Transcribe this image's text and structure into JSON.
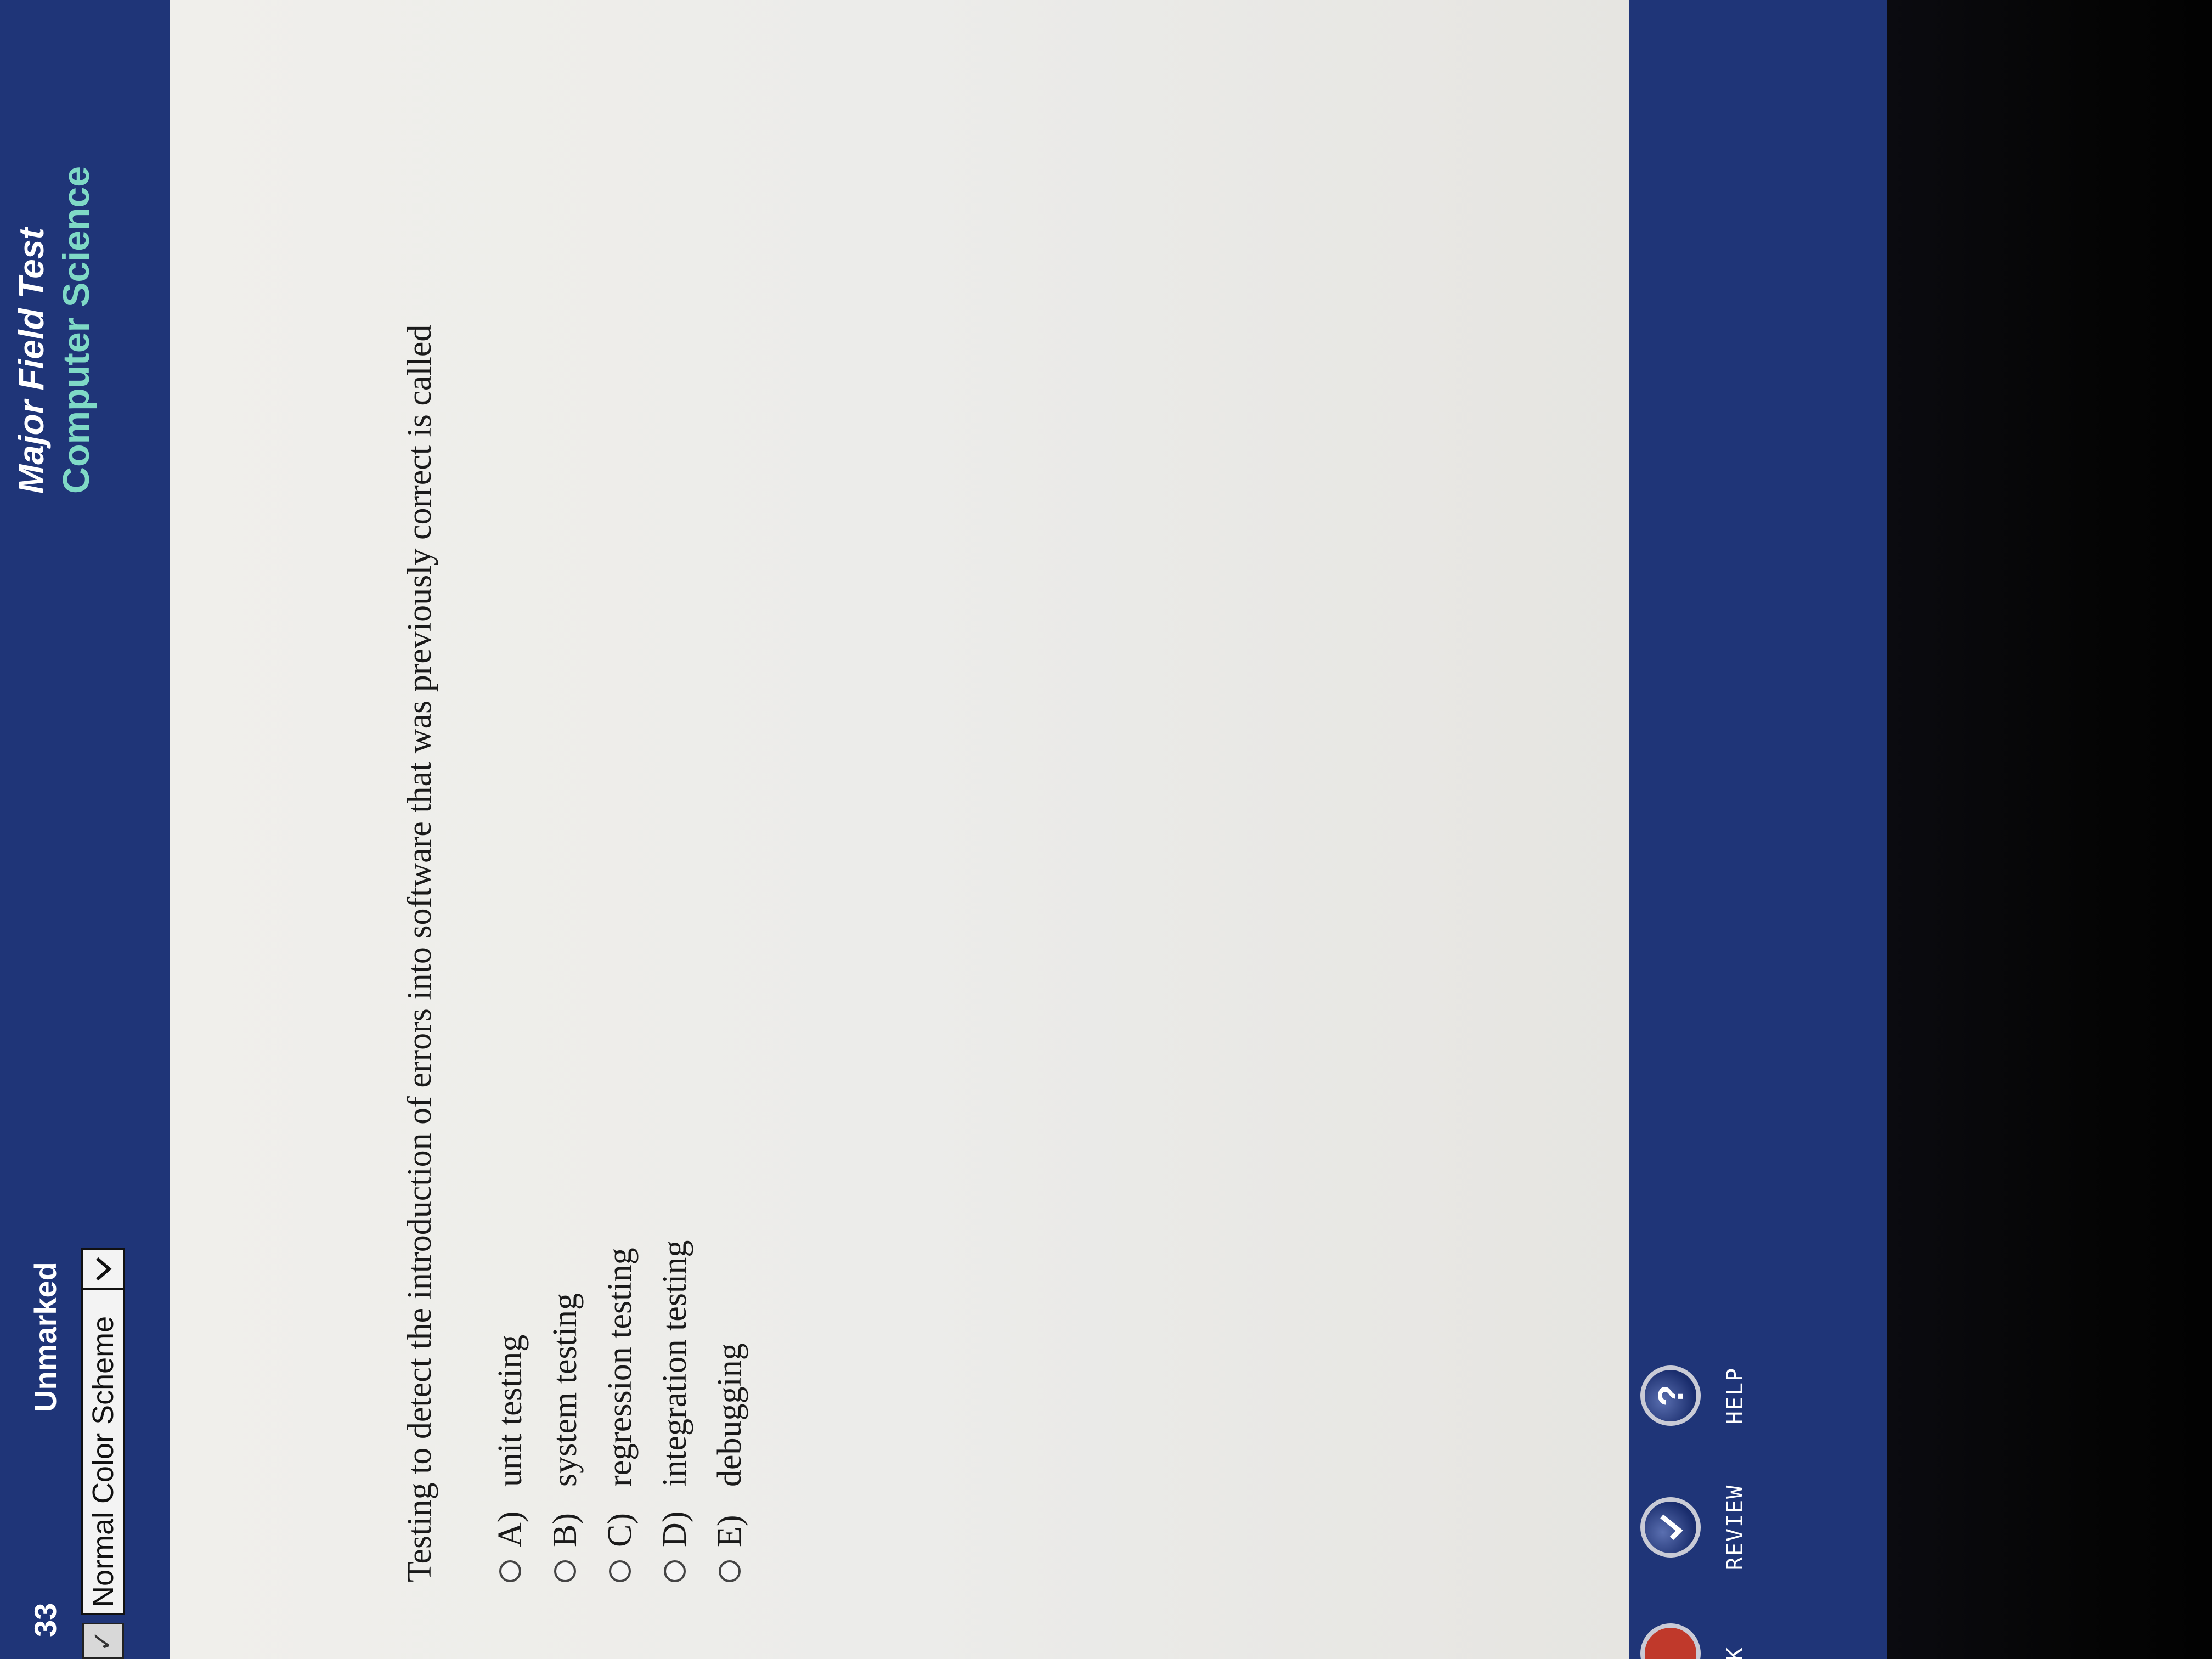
{
  "header": {
    "question_number": "33",
    "mark_status": "Unmarked",
    "color_scheme": {
      "selected": "Normal Color Scheme"
    },
    "test_title": "Major Field Test",
    "test_subject": "Computer Science"
  },
  "question": {
    "text": "Testing to detect the introduction of errors into software that was previously correct is called",
    "options": [
      {
        "letter": "A)",
        "text": "unit testing"
      },
      {
        "letter": "B)",
        "text": "system testing"
      },
      {
        "letter": "C)",
        "text": "regression testing"
      },
      {
        "letter": "D)",
        "text": "integration testing"
      },
      {
        "letter": "E)",
        "text": "debugging"
      }
    ]
  },
  "toolbar": {
    "back_label": "K",
    "review_label": "REVIEW",
    "help_label": "HELP",
    "help_glyph": "?"
  },
  "colors": {
    "chrome_blue": "#1f3578",
    "subject_teal": "#7fd9c6",
    "panel_white": "#ecebe8"
  }
}
